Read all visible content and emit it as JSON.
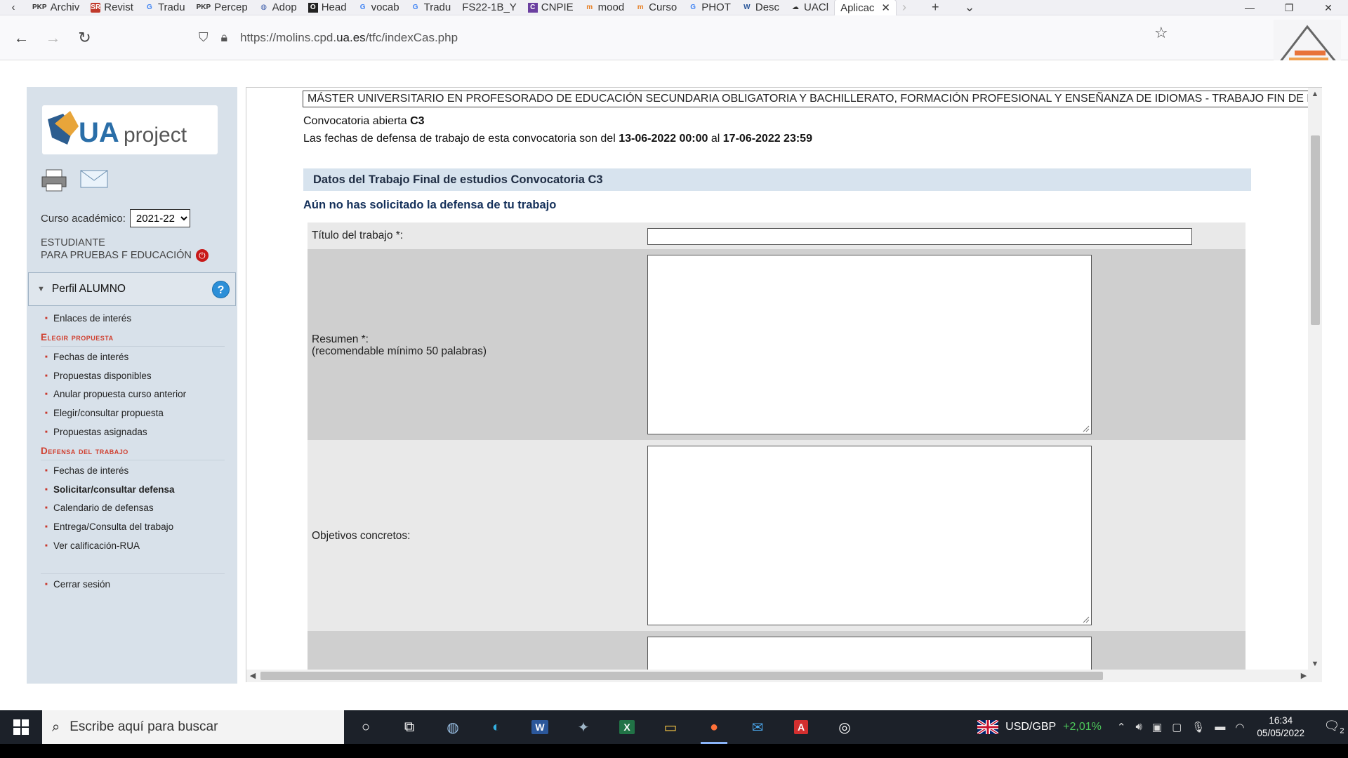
{
  "browser": {
    "tabs": [
      {
        "icon": "PKP",
        "label": "Archiv"
      },
      {
        "icon": "SR",
        "label": "Revist"
      },
      {
        "icon": "G",
        "label": "Tradu"
      },
      {
        "icon": "PKP",
        "label": "Percep"
      },
      {
        "icon": "globe",
        "label": "Adop"
      },
      {
        "icon": "O",
        "label": "Head"
      },
      {
        "icon": "G",
        "label": "vocab"
      },
      {
        "icon": "G",
        "label": "Tradu"
      },
      {
        "icon": "",
        "label": "FS22-1B_Y"
      },
      {
        "icon": "C",
        "label": "CNPIE"
      },
      {
        "icon": "m",
        "label": "mood"
      },
      {
        "icon": "m",
        "label": "Curso"
      },
      {
        "icon": "G",
        "label": "PHOT"
      },
      {
        "icon": "W",
        "label": "Desc"
      },
      {
        "icon": "cloud",
        "label": "UACl"
      },
      {
        "icon": "",
        "label": "Aplicac",
        "active": true
      }
    ],
    "url": {
      "prefix": "https://molins.cpd.",
      "domain": "ua.es",
      "path": "/tfc/indexCas.php"
    }
  },
  "sidebar": {
    "curso_label": "Curso académico:",
    "curso_value": "2021-22",
    "student_line1": "ESTUDIANTE",
    "student_line2": "PARA PRUEBAS F EDUCACIÓN",
    "perfil_label": "Perfil ALUMNO",
    "menu": {
      "enlaces": "Enlaces de interés",
      "section_elegir": "Elegir propuesta",
      "fechas1": "Fechas de interés",
      "propuestas_disp": "Propuestas disponibles",
      "anular": "Anular propuesta curso anterior",
      "elegir_consultar": "Elegir/consultar propuesta",
      "propuestas_asig": "Propuestas asignadas",
      "section_defensa": "Defensa del trabajo",
      "fechas2": "Fechas de interés",
      "solicitar": "Solicitar/consultar defensa",
      "calendario": "Calendario de defensas",
      "entrega": "Entrega/Consulta del trabajo",
      "calificacion": "Ver calificación-RUA",
      "cerrar": "Cerrar sesión"
    }
  },
  "main": {
    "banner": "MÁSTER UNIVERSITARIO EN PROFESORADO DE EDUCACIÓN SECUNDARIA OBLIGATORIA Y BACHILLERATO, FORMACIÓN PROFESIONAL Y ENSEÑANZA DE IDIOMAS - TRABAJO FIN DE MASTE",
    "conv_prefix": "Convocatoria abierta ",
    "conv_code": "C3",
    "dates_prefix": "Las fechas de defensa de trabajo de esta convocatoria son del ",
    "date_start": "13-06-2022 00:00",
    "dates_mid": " al ",
    "date_end": "17-06-2022 23:59",
    "section_title": "Datos del Trabajo Final de estudios Convocatoria C3",
    "notice": "Aún no has solicitado la defensa de tu trabajo",
    "form": {
      "titulo_label": "Título del trabajo *:",
      "titulo_value": "",
      "resumen_label": "Resumen *:",
      "resumen_hint": "(recomendable mínimo 50 palabras)",
      "objetivos_label": "Objetivos concretos:"
    }
  },
  "taskbar": {
    "search_placeholder": "Escribe aquí para buscar",
    "fx_pair": "USD/GBP",
    "fx_change": "+2,01%",
    "time": "16:34",
    "date": "05/05/2022",
    "notifications": "2"
  },
  "colors": {
    "sidebar_bg": "#d8e1ea",
    "section_red": "#d04030",
    "title_bar": "#d7e3ee",
    "taskbar_bg": "#1c2129",
    "fx_positive": "#4cc85a"
  }
}
